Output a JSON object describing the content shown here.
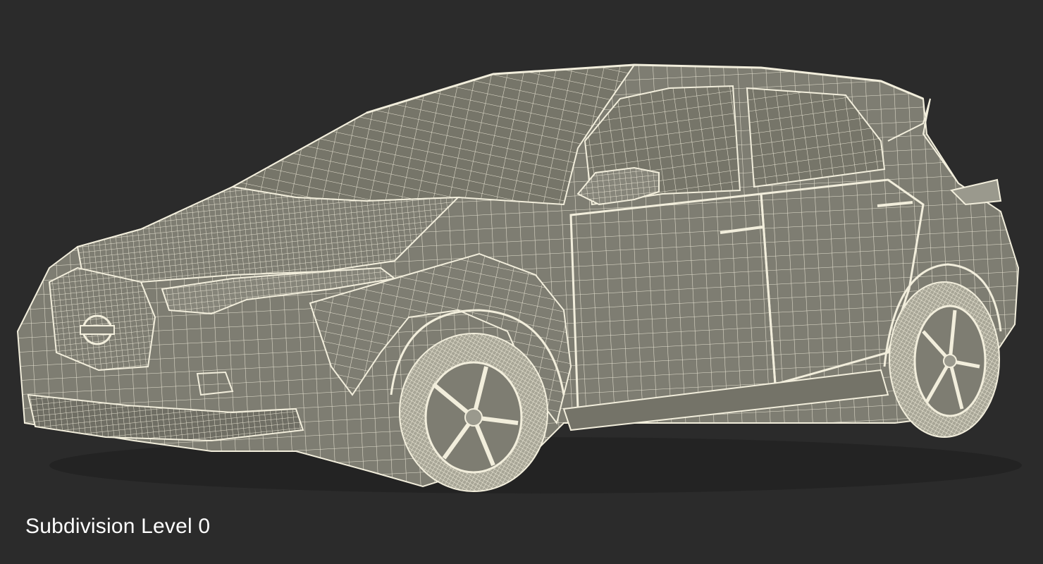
{
  "caption": "Subdivision Level 0",
  "colors": {
    "background": "#2b2b2b",
    "body_fill": "#7e7d72",
    "glass_fill": "#767569",
    "wire": "#f2eedc",
    "shadow": "#555449"
  }
}
